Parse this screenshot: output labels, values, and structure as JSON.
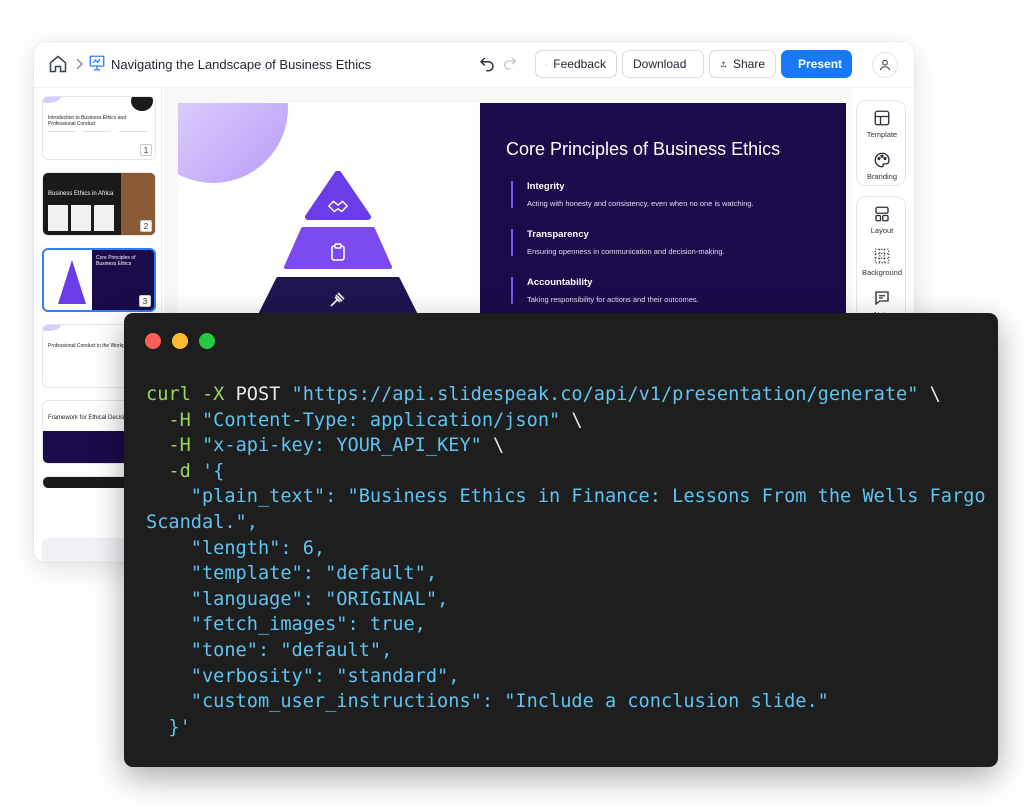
{
  "app": {
    "deck_title": "Navigating the Landscape of Business Ethics",
    "buttons": {
      "feedback": "Feedback",
      "download": "Download",
      "share": "Share",
      "present": "Present"
    },
    "accent_color": "#1779f5"
  },
  "thumbnails": [
    {
      "number": "1",
      "title": "Introduction to Business Ethics and Professional Conduct"
    },
    {
      "number": "2",
      "title": "Business Ethics in Africa"
    },
    {
      "number": "3",
      "title": "Core Principles of Business Ethics"
    },
    {
      "number": "",
      "title": "Professional Conduct in the Workplace"
    },
    {
      "number": "",
      "title": "Framework for Ethical Decision"
    }
  ],
  "add_slide_label": "+",
  "slide": {
    "title": "Core Principles of Business Ethics",
    "points": [
      {
        "heading": "Integrity",
        "text": "Acting with honesty and consistency, even when no one is watching."
      },
      {
        "heading": "Transparency",
        "text": "Ensuring openness in communication and decision-making."
      },
      {
        "heading": "Accountability",
        "text": "Taking responsibility for actions and their outcomes."
      }
    ],
    "background_color": "#1b0b4a",
    "pyramid_colors": [
      "#6a3de8",
      "#7b4af0",
      "#1f1550"
    ]
  },
  "tools": {
    "template": "Template",
    "branding": "Branding",
    "layout": "Layout",
    "background": "Background",
    "notes": "Note"
  },
  "terminal": {
    "lines": [
      {
        "cmd": "curl",
        "flag": " -X ",
        "plain": "POST ",
        "str": "\"https://api.slidespeak.co/api/v1/presentation/generate\"",
        "tail": " \\"
      },
      {
        "indent": "  ",
        "flag": "-H ",
        "str": "\"Content-Type: application/json\"",
        "tail": " \\"
      },
      {
        "indent": "  ",
        "flag": "-H ",
        "str": "\"x-api-key: YOUR_API_KEY\"",
        "tail": " \\"
      },
      {
        "indent": "  ",
        "flag": "-d ",
        "str": "'{"
      },
      {
        "indent": "    ",
        "str": "\"plain_text\": \"Business Ethics in Finance: Lessons From the Wells Fargo Scandal.\","
      },
      {
        "indent": "    ",
        "str": "\"length\": 6,"
      },
      {
        "indent": "    ",
        "str": "\"template\": \"default\","
      },
      {
        "indent": "    ",
        "str": "\"language\": \"ORIGINAL\","
      },
      {
        "indent": "    ",
        "str": "\"fetch_images\": true,"
      },
      {
        "indent": "    ",
        "str": "\"tone\": \"default\","
      },
      {
        "indent": "    ",
        "str": "\"verbosity\": \"standard\","
      },
      {
        "indent": "    ",
        "str": "\"custom_user_instructions\": \"Include a conclusion slide.\""
      },
      {
        "indent": "  ",
        "str": "}'"
      }
    ],
    "dot_colors": [
      "#ff5f57",
      "#febc2e",
      "#28c840"
    ]
  }
}
